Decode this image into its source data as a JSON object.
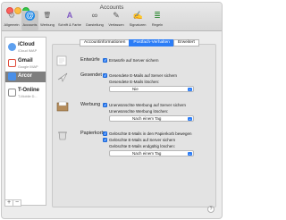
{
  "window": {
    "title": "Accounts"
  },
  "toolbar": [
    {
      "label": "Allgemein",
      "icon": "gear-icon",
      "glyph": "⚙",
      "color": "#8e8e93"
    },
    {
      "label": "Accounts",
      "icon": "at-icon",
      "glyph": "@",
      "color": "#1e88e5"
    },
    {
      "label": "Werbung",
      "icon": "junk-icon",
      "glyph": "🗑",
      "color": "#8d6e63"
    },
    {
      "label": "Schrift & Farbe",
      "icon": "fonts-colors-icon",
      "glyph": "A",
      "color": "#7e57c2"
    },
    {
      "label": "Darstellung",
      "icon": "glasses-icon",
      "glyph": "∞",
      "color": "#424242"
    },
    {
      "label": "Verfassen",
      "icon": "compose-icon",
      "glyph": "✎",
      "color": "#616161"
    },
    {
      "label": "Signaturen",
      "icon": "signature-icon",
      "glyph": "✍",
      "color": "#616161"
    },
    {
      "label": "Regeln",
      "icon": "rules-icon",
      "glyph": "≣",
      "color": "#388e3c"
    }
  ],
  "accounts": [
    {
      "name": "iCloud",
      "sub": "iCloud IMAP",
      "icon": "cloud-icon",
      "color": "#5ea0ef"
    },
    {
      "name": "Gmail",
      "sub": "Google IMAP",
      "icon": "gmail-icon",
      "color": "#e04b3a"
    },
    {
      "name": "Arcor",
      "sub": "",
      "icon": "mail-account-icon",
      "color": "#4a8fe7"
    },
    {
      "name": "T-Online",
      "sub": "T-Mobile D...",
      "icon": "t-online-icon",
      "color": "#e20074"
    }
  ],
  "sidebar_buttons": {
    "add": "+",
    "remove": "−"
  },
  "tabs": [
    {
      "label": "Accountinformationen"
    },
    {
      "label": "Postfach-Verhalten"
    },
    {
      "label": "Erweitert"
    }
  ],
  "sections": {
    "drafts": {
      "title": "Entwürfe",
      "option": "Entwürfe auf Server sichern"
    },
    "sent": {
      "title": "Gesendet",
      "option": "Gesendete E-Mails auf Server sichern",
      "sublabel": "Gesendete E-Mails löschen:",
      "value": "Nie"
    },
    "junk": {
      "title": "Werbung",
      "option": "Unerwünschte Werbung auf Server sichern",
      "sublabel": "Unerwünschte Werbung löschen:",
      "value": "Nach einem Tag"
    },
    "trash": {
      "title": "Papierkorb",
      "option1": "Gelöschte E-Mails in den Papierkorb bewegen",
      "option2": "Gelöschte E-Mails auf Server sichern",
      "sublabel": "Gelöschte E-Mails endgültig löschen:",
      "value": "Nach einem Tag"
    }
  },
  "help": {
    "glyph": "?"
  }
}
